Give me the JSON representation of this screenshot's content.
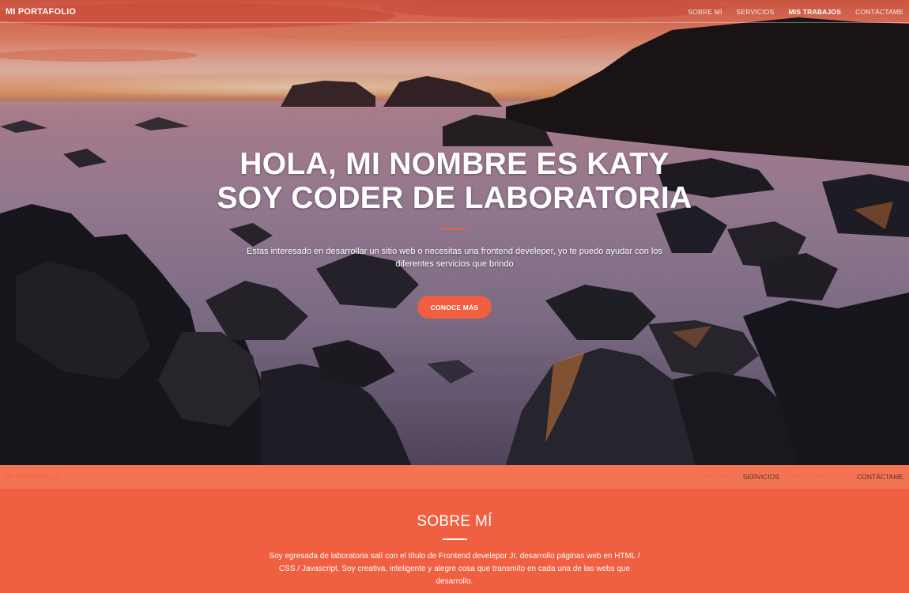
{
  "nav": {
    "brand": "MI PORTAFOLIO",
    "links": [
      {
        "label": "SOBRE MÍ"
      },
      {
        "label": "SERVICIOS"
      },
      {
        "label": "MIS TRABAJOS"
      },
      {
        "label": "CONTÁCTAME"
      }
    ]
  },
  "hero": {
    "title_line1": "HOLA, MI NOMBRE ES KATY",
    "title_line2": "SOY CODER DE LABORATORIA",
    "subtitle": "Estas interesado en desarrollar un sitio web o necesitas una frontend develeper, yo te puedo ayudar con los diferentes servicios que brindo",
    "cta_label": "CONOCE MÁS"
  },
  "about": {
    "title": "SOBRE MÍ",
    "text": "Soy egresada de laboratoria salí con el título de Frontend develepor Jr. desarrollo páginas web en HTML / CSS / Javascript. Soy creativa, inteligente y alegre cosa que transmito en cada una de las webs que desarrollo."
  },
  "colors": {
    "accent": "#f05f40",
    "sticky_nav_bg": "#f27453"
  }
}
